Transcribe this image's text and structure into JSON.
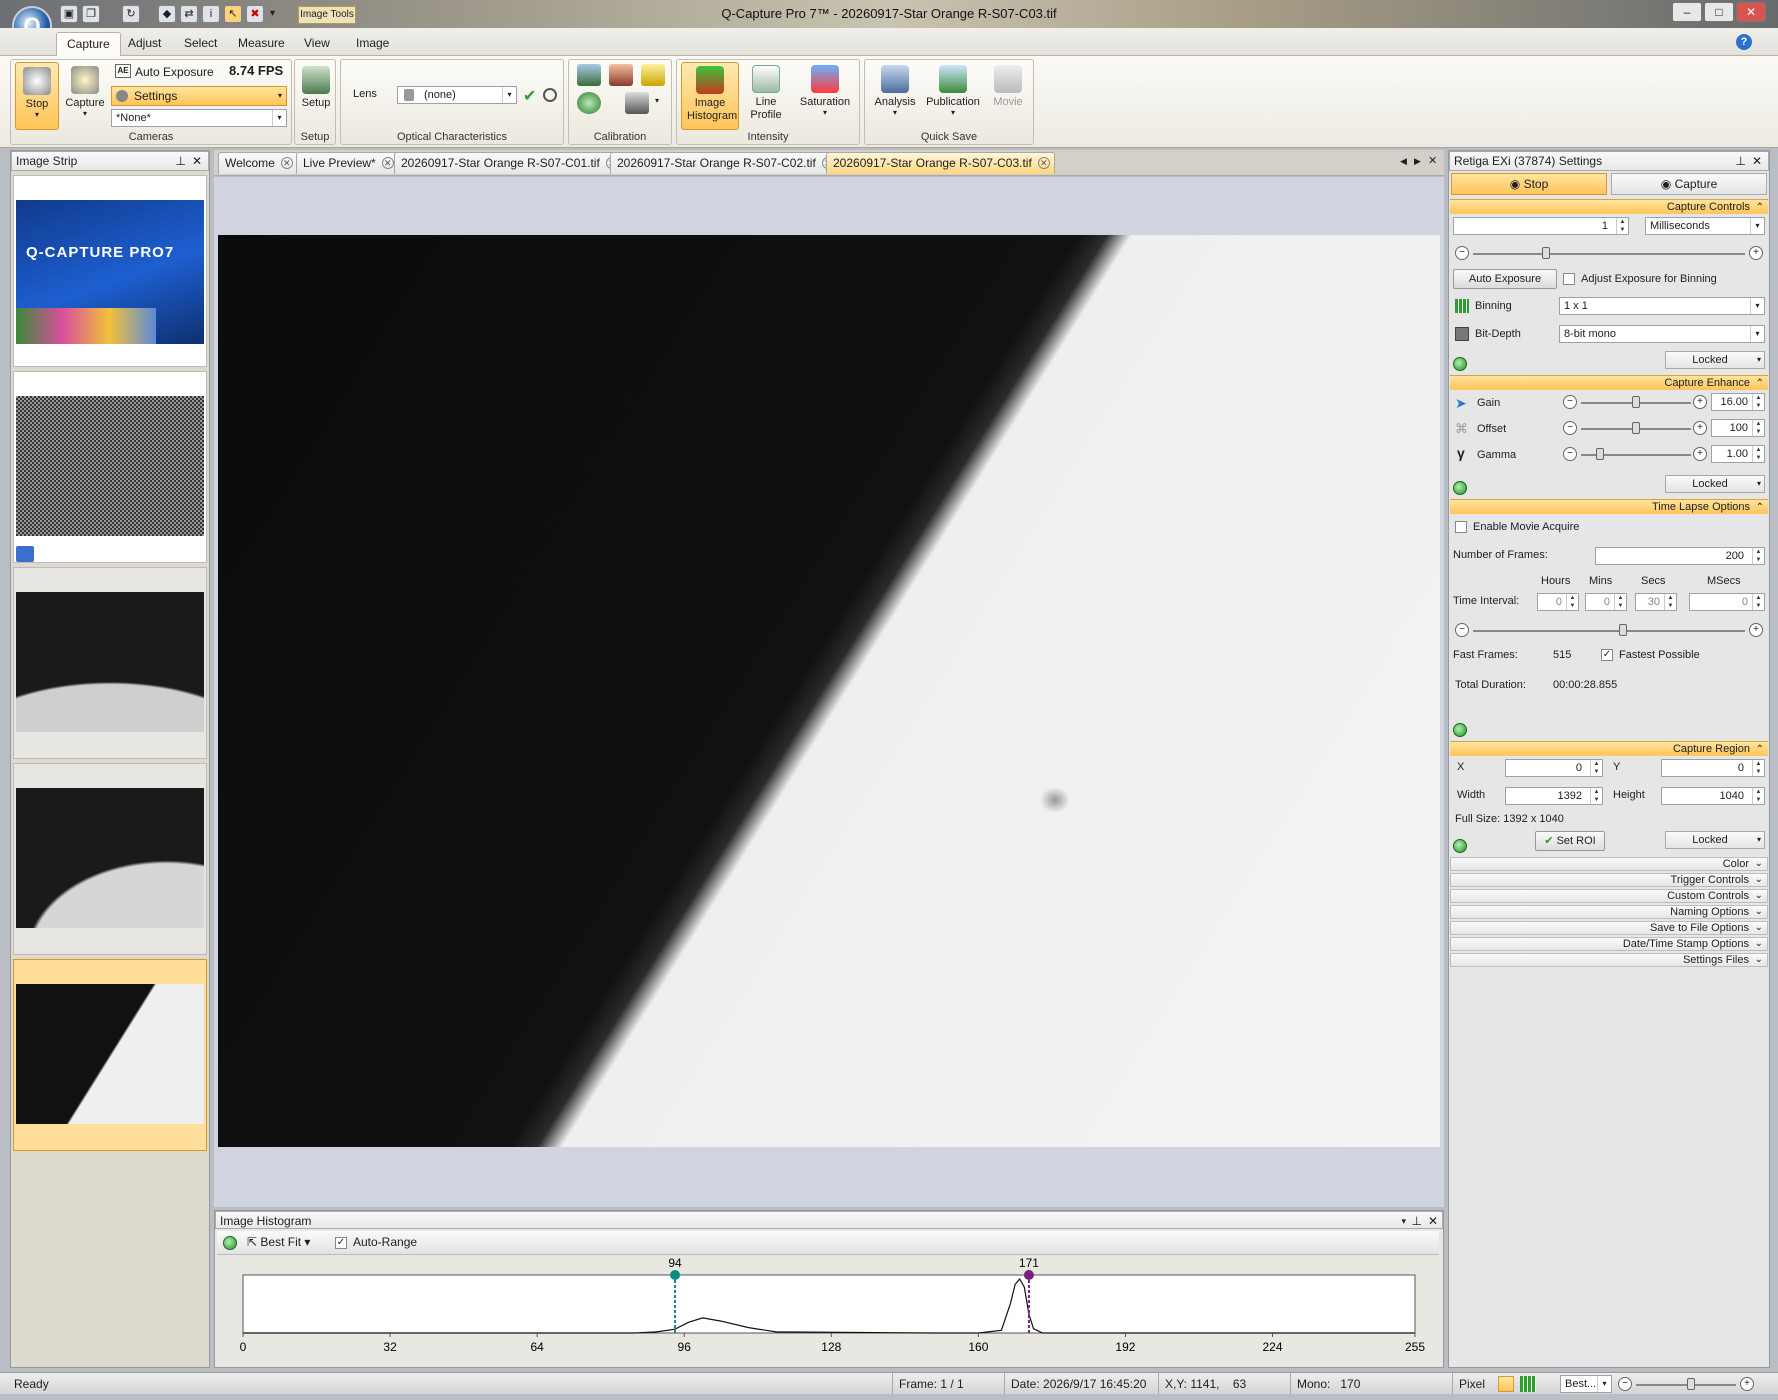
{
  "titlebar": {
    "title": "Q-Capture Pro 7™ - 20260917-Star Orange R-S07-C03.tif",
    "contextual_tab": "Image Tools",
    "logo_letter": "Q"
  },
  "ribbon_tabs": [
    "Capture",
    "Adjust",
    "Select",
    "Measure",
    "View",
    "Image"
  ],
  "ribbon": {
    "stop": "Stop",
    "capture": "Capture",
    "auto_exposure": "Auto Exposure",
    "fps": "8.74 FPS",
    "settings": "Settings",
    "none_preset": "*None*",
    "cameras_group": "Cameras",
    "setup": "Setup",
    "setup_group": "Setup",
    "lens_label": "Lens",
    "lens_value": "(none)",
    "optical_group": "Optical Characteristics",
    "calibration_group": "Calibration",
    "image_histogram": "Image Histogram",
    "line_profile": "Line Profile",
    "saturation": "Saturation",
    "intensity_group": "Intensity",
    "analysis": "Analysis",
    "publication": "Publication",
    "movie": "Movie",
    "quicksave_group": "Quick Save"
  },
  "image_strip": {
    "title": "Image Strip",
    "splash_title": "Q-CAPTURE PRO7"
  },
  "doc_tabs": [
    "Welcome",
    "Live Preview*",
    "20260917-Star Orange R-S07-C01.tif",
    "20260917-Star Orange R-S07-C02.tif",
    "20260917-Star Orange R-S07-C03.tif"
  ],
  "active_doc_tab": 4,
  "settings_panel": {
    "title": "Retiga EXi (37874) Settings",
    "stop": "Stop",
    "capture": "Capture",
    "capture_controls": {
      "header": "Capture Controls",
      "exposure_value": "1",
      "exposure_unit": "Milliseconds",
      "exposure_slider_fraction": 0.27,
      "auto_exposure_btn": "Auto Exposure",
      "adjust_binning": "Adjust Exposure for Binning",
      "binning_label": "Binning",
      "binning_value": "1 x 1",
      "bitdepth_label": "Bit-Depth",
      "bitdepth_value": "8-bit mono",
      "locked": "Locked"
    },
    "capture_enhance": {
      "header": "Capture Enhance",
      "rows": [
        {
          "label": "Gain",
          "value": "16.00",
          "fraction": 0.5
        },
        {
          "label": "Offset",
          "value": "100",
          "fraction": 0.5
        },
        {
          "label": "Gamma",
          "value": "1.00",
          "fraction": 0.17
        }
      ],
      "locked": "Locked"
    },
    "time_lapse": {
      "header": "Time Lapse Options",
      "enable_movie": "Enable Movie Acquire",
      "frames_label": "Number of  Frames:",
      "frames_value": "200",
      "hours": "Hours",
      "mins": "Mins",
      "secs": "Secs",
      "msecs": "MSecs",
      "interval_label": "Time Interval:",
      "interval_values": [
        "0",
        "0",
        "30",
        "0"
      ],
      "interval_slider_fraction": 0.55,
      "fast_frames_label": "Fast Frames:",
      "fast_frames_value": "515",
      "fastest_possible": "Fastest Possible",
      "total_duration_label": "Total Duration:",
      "total_duration_value": "00:00:28.855"
    },
    "capture_region": {
      "header": "Capture Region",
      "x_label": "X",
      "x_value": "0",
      "y_label": "Y",
      "y_value": "0",
      "width_label": "Width",
      "width_value": "1392",
      "height_label": "Height",
      "height_value": "1040",
      "full_size": "Full Size: 1392 x 1040",
      "set_roi": "Set ROI",
      "locked": "Locked"
    },
    "collapsed_sections": [
      "Color",
      "Trigger Controls",
      "Custom Controls",
      "Naming Options",
      "Save to File Options",
      "Date/Time Stamp Options",
      "Settings Files"
    ]
  },
  "histogram": {
    "title": "Image Histogram",
    "best_fit": "Best Fit",
    "auto_range": "Auto-Range",
    "ticks": [
      "0",
      "32",
      "64",
      "96",
      "128",
      "160",
      "192",
      "224",
      "255"
    ],
    "black_marker": 94,
    "white_marker": 171,
    "black_label": "94",
    "white_label": "171",
    "black_color": "#0f8a84",
    "white_color": "#7a1f7a"
  },
  "chart_data": {
    "type": "line",
    "title": "",
    "xlabel": "",
    "ylabel": "",
    "xlim": [
      0,
      255
    ],
    "series": [
      {
        "x": [
          0,
          85,
          90,
          94,
          97,
          100,
          104,
          110,
          116,
          150,
          160,
          165,
          167,
          168,
          169,
          170,
          171,
          172,
          174,
          180,
          255
        ],
        "y": [
          0,
          0,
          0.02,
          0.07,
          0.2,
          0.28,
          0.22,
          0.1,
          0.02,
          0,
          0,
          0.05,
          0.55,
          0.9,
          1.0,
          0.85,
          0.35,
          0.08,
          0,
          0,
          0
        ]
      }
    ]
  },
  "statusbar": {
    "ready": "Ready",
    "frame": "Frame: 1 / 1",
    "date": "Date: 2026/9/17 16:45:20",
    "xy": "X,Y: 1141,    63",
    "mono": "Mono:   170",
    "pixel": "Pixel",
    "zoom": "Best...",
    "zoom_fraction": 0.55
  }
}
